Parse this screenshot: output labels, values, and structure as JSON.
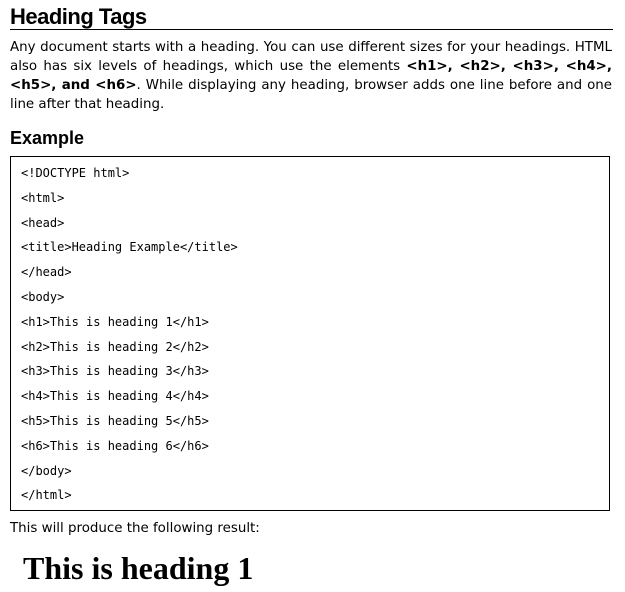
{
  "section_title": "Heading Tags",
  "intro": {
    "part1": "Any document starts with a heading. You can use different sizes for your headings. HTML also has six levels of headings, which use the elements ",
    "tags": "<h1>, <h2>, <h3>, <h4>, <h5>, and <h6>",
    "part2": ". While displaying any heading, browser adds one line before and one line after that heading."
  },
  "example_title": "Example",
  "code_lines": [
    "<!DOCTYPE html>",
    "<html>",
    "<head>",
    "<title>Heading Example</title>",
    "</head>",
    "<body>",
    "<h1>This is heading 1</h1>",
    "<h2>This is heading 2</h2>",
    "<h3>This is heading 3</h3>",
    "<h4>This is heading 4</h4>",
    "<h5>This is heading 5</h5>",
    "<h6>This is heading 6</h6>",
    "</body>",
    "</html>"
  ],
  "result_intro": "This will produce the following result:",
  "result_heading": "This is heading 1"
}
